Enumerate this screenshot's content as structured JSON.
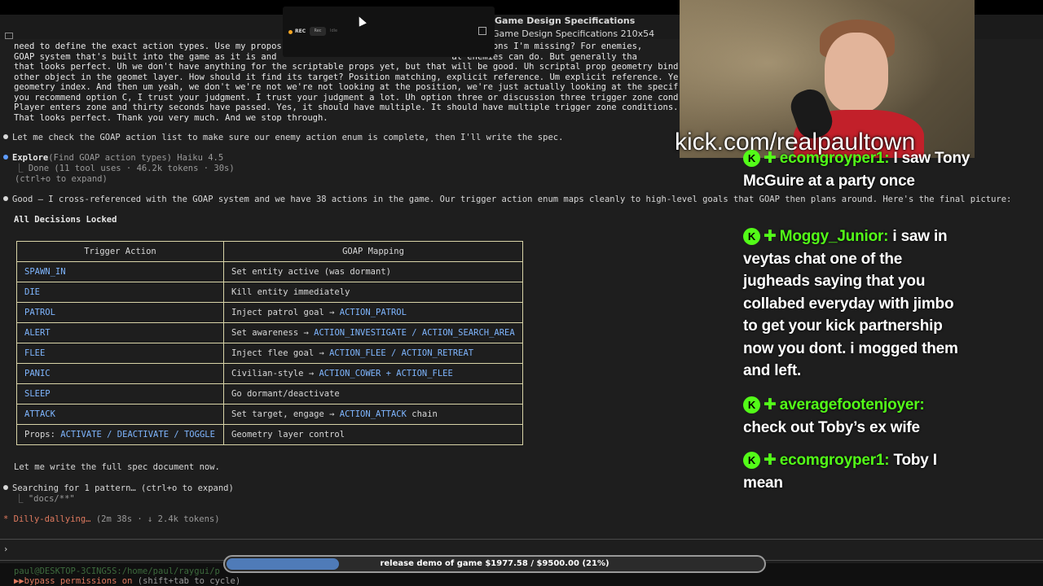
{
  "window": {
    "title_line1": "Game Design Specifications",
    "title_line2": "Game Design Specifications 210x54"
  },
  "recorder": {
    "rec_label": "REC",
    "rec_button": "Rec",
    "idle_button": "Idle"
  },
  "transcript": [
    "need to define the exact action types. Use my propos                                  re actions I'm missing? For enemies,                                     Um at the go",
    "GOAP system that's built into the game as it is and                                  at enemies can do. But generally tha                                    toggle. Yes,",
    "that looks perfect. Uh we don't have anything for the scriptable props yet, but that will be good. Uh scriptal prop geometry bind                           rol a light o",
    "other object in the geomet layer. How should it find its target? Position matching, explicit reference. Um explicit reference. Ye                         We want prop",
    "geometry index. And then um yeah, we don't we're not we're not looking at the position, we're just actually looking at the specif                          do option C.",
    "you recommend option C, I trust your judgment. I trust your judgment a lot. Uh option three or discussion three trigger zone cond                          ple condition",
    "Player enters zone and thirty seconds have passed. Yes, it should have multiple. It should have multiple trigger zone conditions.                          es sense. Man",
    "That looks perfect. Thank you very much. And we stop through."
  ],
  "assistant": {
    "check_msg": "Let me check the GOAP action list to make sure our enemy action enum is complete, then I'll write the spec.",
    "explore_tool": "Explore",
    "explore_args": "(Find GOAP action types) Haiku 4.5",
    "explore_result": "Done (11 tool uses · 46.2k tokens · 30s)",
    "expand_hint": "(ctrl+o to expand)",
    "good_msg": "Good — I cross-referenced with the GOAP system and we have 38 actions in the game. Our trigger action enum maps cleanly to high-level goals that GOAP then plans around. Here's the final picture:",
    "decisions_heading": "All Decisions Locked",
    "write_msg": "Let me write the full spec document now.",
    "search_msg": "Searching for 1 pattern… (ctrl+o to expand)",
    "search_pattern": "\"docs/**\"",
    "status_word": "Dilly-dallying…",
    "status_info": "(2m 38s · ↓ 2.4k tokens)"
  },
  "table": {
    "headers": [
      "Trigger Action",
      "GOAP Mapping"
    ],
    "rows": [
      {
        "action": "SPAWN_IN",
        "mapping_pre": "Set entity active (was dormant)",
        "mapping_ids": ""
      },
      {
        "action": "DIE",
        "mapping_pre": "Kill entity immediately",
        "mapping_ids": ""
      },
      {
        "action": "PATROL",
        "mapping_pre": "Inject patrol goal → ",
        "mapping_ids": "ACTION_PATROL"
      },
      {
        "action": "ALERT",
        "mapping_pre": "Set awareness → ",
        "mapping_ids": "ACTION_INVESTIGATE / ACTION_SEARCH_AREA"
      },
      {
        "action": "FLEE",
        "mapping_pre": "Inject flee goal → ",
        "mapping_ids": "ACTION_FLEE / ACTION_RETREAT"
      },
      {
        "action": "PANIC",
        "mapping_pre": "Civilian-style → ",
        "mapping_ids": "ACTION_COWER + ACTION_FLEE"
      },
      {
        "action": "SLEEP",
        "mapping_pre": "Go dormant/deactivate",
        "mapping_ids": ""
      },
      {
        "action": "ATTACK",
        "mapping_pre": "Set target, engage → ",
        "mapping_ids": "ACTION_ATTACK",
        "mapping_post": " chain"
      }
    ],
    "props_label": "Props: ",
    "props_values": "ACTIVATE / DEACTIVATE / TOGGLE",
    "props_mapping": "Geometry layer control"
  },
  "prompt": {
    "symbol": "›",
    "path": "paul@DESKTOP-3CING5S:/home/paul/raygui/p",
    "mode": "bypass permissions on",
    "mode_hint": "(shift+tab to cycle)"
  },
  "overlay": {
    "kick_url": "kick.com/realpaultown",
    "chat": [
      {
        "user": "ecomgroyper1:",
        "msg": "I saw Tony McGuire at a party once"
      },
      {
        "user": "Moggy_Junior:",
        "msg": "i saw in veytas chat one of the jugheads saying that you collabed everyday with jimbo to get your kick partnership now you dont. i mogged them and left."
      },
      {
        "user": "averagefootenjoyer:",
        "msg": "check out Toby’s ex wife"
      },
      {
        "user": "ecomgroyper1:",
        "msg": "Toby I mean"
      }
    ],
    "goal_text": "release demo of game $1977.58 / $9500.00 (21%)",
    "goal_fraction": 0.21
  },
  "colors": {
    "kick_green": "#53fc18",
    "progress_fill": "#4f7bb8",
    "terminal_bg": "#1e1e1e",
    "table_border": "#d9d4a8",
    "identifier_blue": "#7fb6ff"
  }
}
